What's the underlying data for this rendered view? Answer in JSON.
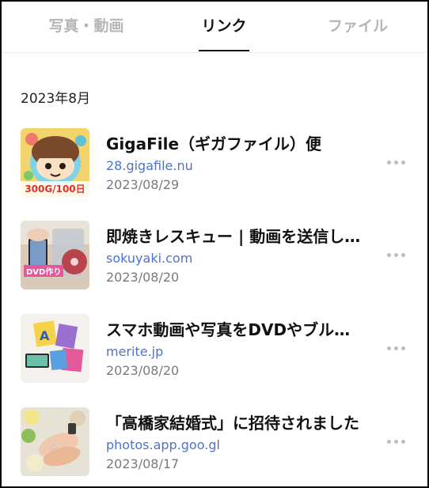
{
  "tabs": {
    "photos_videos": "写真・動画",
    "links": "リンク",
    "files": "ファイル",
    "active": "links"
  },
  "section": {
    "title": "2023年8月"
  },
  "links": [
    {
      "title": "GigaFile（ギガファイル）便",
      "domain": "28.gigafile.nu",
      "date": "2023/08/29",
      "thumb_caption": "300G/100日"
    },
    {
      "title": "即焼きレスキュー | 動画を送信し…",
      "domain": "sokuyaki.com",
      "date": "2023/08/20",
      "thumb_caption": "DVD作り"
    },
    {
      "title": "スマホ動画や写真をDVDやブル…",
      "domain": "merite.jp",
      "date": "2023/08/20",
      "thumb_caption": "A"
    },
    {
      "title": "「高橋家結婚式」に招待されました",
      "domain": "photos.app.goo.gl",
      "date": "2023/08/17",
      "thumb_caption": ""
    }
  ],
  "colors": {
    "link_domain": "#4f72c9",
    "date": "#7a7a7a",
    "inactive_tab": "#b6b6b6",
    "active_tab": "#111111"
  }
}
